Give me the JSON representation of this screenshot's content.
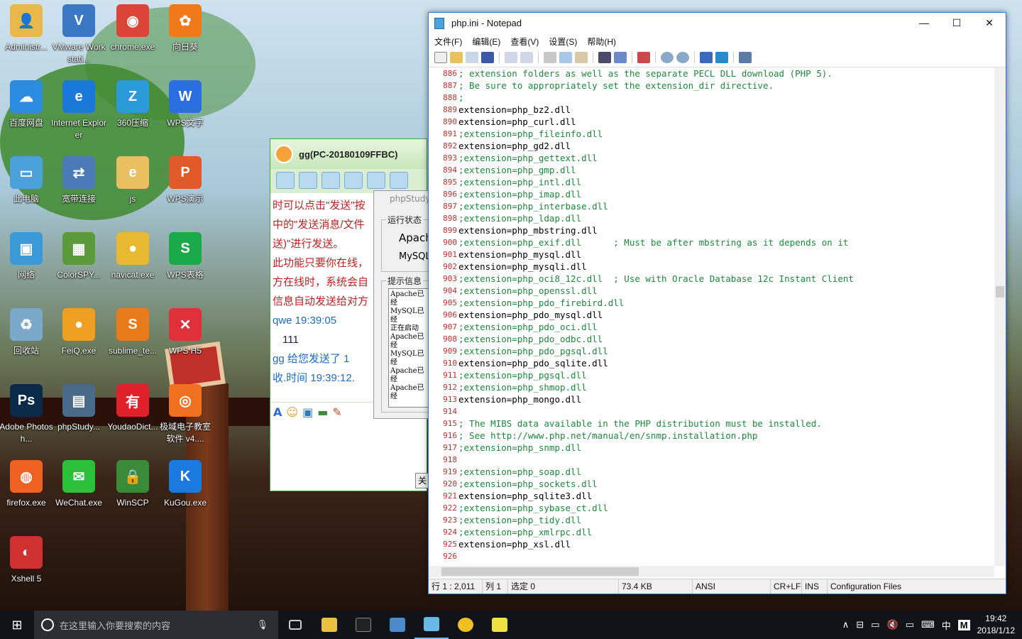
{
  "desktop": {
    "icons": [
      {
        "label": "Administr...",
        "color": "#e8b84a",
        "glyph": "👤"
      },
      {
        "label": "VMware Workstati...",
        "color": "#3a78c4",
        "glyph": "V"
      },
      {
        "label": "chrome.exe",
        "color": "#db4437",
        "glyph": "◉"
      },
      {
        "label": "向日葵",
        "color": "#f07a1a",
        "glyph": "✿"
      },
      {
        "label": "百度网盘",
        "color": "#2a8be0",
        "glyph": "☁"
      },
      {
        "label": "Internet Explorer",
        "color": "#1a78d8",
        "glyph": "e"
      },
      {
        "label": "360压缩",
        "color": "#2a9ad8",
        "glyph": "Z"
      },
      {
        "label": "WPS文字",
        "color": "#2a6ee0",
        "glyph": "W"
      },
      {
        "label": "此电脑",
        "color": "#4aa0d8",
        "glyph": "▭"
      },
      {
        "label": "宽带连接",
        "color": "#4a7ab8",
        "glyph": "⇄"
      },
      {
        "label": "js",
        "color": "#e8c060",
        "glyph": "e"
      },
      {
        "label": "WPS演示",
        "color": "#e05a2a",
        "glyph": "P"
      },
      {
        "label": "网络",
        "color": "#3a9ad8",
        "glyph": "▣"
      },
      {
        "label": "ColorSPY...",
        "color": "#5a9a3a",
        "glyph": "▦"
      },
      {
        "label": "navicat.exe",
        "color": "#e8b830",
        "glyph": "●"
      },
      {
        "label": "WPS表格",
        "color": "#1aaa4a",
        "glyph": "S"
      },
      {
        "label": "回收站",
        "color": "#7aa8c8",
        "glyph": "♻"
      },
      {
        "label": "FeiQ.exe",
        "color": "#f0a020",
        "glyph": "●"
      },
      {
        "label": "sublime_te...",
        "color": "#e87a1a",
        "glyph": "S"
      },
      {
        "label": "WPS H5",
        "color": "#e0303a",
        "glyph": "✕"
      },
      {
        "label": "Adobe Photosh...",
        "color": "#0a2a4a",
        "glyph": "Ps"
      },
      {
        "label": "phpStudy...",
        "color": "#4a6a8a",
        "glyph": "▤"
      },
      {
        "label": "YoudaoDict...",
        "color": "#e0202a",
        "glyph": "有"
      },
      {
        "label": "极域电子教室软件 v4....",
        "color": "#f07020",
        "glyph": "◎"
      },
      {
        "label": "firefox.exe",
        "color": "#f06020",
        "glyph": "◍"
      },
      {
        "label": "WeChat.exe",
        "color": "#2ac03a",
        "glyph": "✉"
      },
      {
        "label": "WinSCP",
        "color": "#3a8a3a",
        "glyph": "🔒"
      },
      {
        "label": "KuGou.exe",
        "color": "#1a7ae0",
        "glyph": "K"
      },
      {
        "label": "Xshell 5",
        "color": "#d03030",
        "glyph": "◐"
      }
    ]
  },
  "chat": {
    "title": "gg(PC-20180109FFBC)",
    "messages": [
      {
        "cls": "red",
        "text": "时可以点击\"发送\"按"
      },
      {
        "cls": "red",
        "text": "中的\"发送消息/文件"
      },
      {
        "cls": "red",
        "text": "送)\"进行发送。"
      },
      {
        "cls": "red",
        "text": "此功能只要你在线，"
      },
      {
        "cls": "red",
        "text": "方在线时，系统会自"
      },
      {
        "cls": "red",
        "text": "信息自动发送给对方"
      },
      {
        "cls": "blue",
        "text": "qwe 19:39:05"
      },
      {
        "cls": "ind",
        "text": "111"
      },
      {
        "cls": "blue",
        "text": "gg 给您发送了 1"
      },
      {
        "cls": "blue",
        "text": "收.时间 19:39:12."
      }
    ],
    "close_label": "关"
  },
  "phpstudy": {
    "title": "phpStudy",
    "status_group": "运行状态",
    "apache": "Apach",
    "mysql": "MySQL",
    "info_group": "提示信息",
    "log": [
      "Apache已经",
      "MySQL已经",
      "正在启动",
      "Apache已经",
      "MySQL已经",
      "Apache已经",
      "Apache已经"
    ]
  },
  "notepad": {
    "title": "php.ini - Notepad",
    "menu": [
      "文件(F)",
      "编辑(E)",
      "查看(V)",
      "设置(S)",
      "帮助(H)"
    ],
    "lines": [
      {
        "n": "886",
        "t": "; extension folders as well as the separate PECL DLL download (PHP 5).",
        "c": true
      },
      {
        "n": "887",
        "t": "; Be sure to appropriately set the extension_dir directive.",
        "c": true
      },
      {
        "n": "888",
        "t": ";",
        "c": true
      },
      {
        "n": "889",
        "t": "extension=php_bz2.dll",
        "c": false
      },
      {
        "n": "890",
        "t": "extension=php_curl.dll",
        "c": false
      },
      {
        "n": "891",
        "t": ";extension=php_fileinfo.dll",
        "c": true
      },
      {
        "n": "892",
        "t": "extension=php_gd2.dll",
        "c": false
      },
      {
        "n": "893",
        "t": ";extension=php_gettext.dll",
        "c": true
      },
      {
        "n": "894",
        "t": ";extension=php_gmp.dll",
        "c": true
      },
      {
        "n": "895",
        "t": ";extension=php_intl.dll",
        "c": true
      },
      {
        "n": "896",
        "t": ";extension=php_imap.dll",
        "c": true
      },
      {
        "n": "897",
        "t": ";extension=php_interbase.dll",
        "c": true
      },
      {
        "n": "898",
        "t": ";extension=php_ldap.dll",
        "c": true
      },
      {
        "n": "899",
        "t": "extension=php_mbstring.dll",
        "c": false
      },
      {
        "n": "900",
        "t": ";extension=php_exif.dll      ; Must be after mbstring as it depends on it",
        "c": true
      },
      {
        "n": "901",
        "t": "extension=php_mysql.dll",
        "c": false
      },
      {
        "n": "902",
        "t": "extension=php_mysqli.dll",
        "c": false
      },
      {
        "n": "903",
        "t": ";extension=php_oci8_12c.dll  ; Use with Oracle Database 12c Instant Client",
        "c": true
      },
      {
        "n": "904",
        "t": ";extension=php_openssl.dll",
        "c": true
      },
      {
        "n": "905",
        "t": ";extension=php_pdo_firebird.dll",
        "c": true
      },
      {
        "n": "906",
        "t": "extension=php_pdo_mysql.dll",
        "c": false
      },
      {
        "n": "907",
        "t": ";extension=php_pdo_oci.dll",
        "c": true
      },
      {
        "n": "908",
        "t": ";extension=php_pdo_odbc.dll",
        "c": true
      },
      {
        "n": "909",
        "t": ";extension=php_pdo_pgsql.dll",
        "c": true
      },
      {
        "n": "910",
        "t": "extension=php_pdo_sqlite.dll",
        "c": false
      },
      {
        "n": "911",
        "t": ";extension=php_pgsql.dll",
        "c": true
      },
      {
        "n": "912",
        "t": ";extension=php_shmop.dll",
        "c": true
      },
      {
        "n": "913",
        "t": "extension=php_mongo.dll",
        "c": false
      },
      {
        "n": "914",
        "t": "",
        "c": false
      },
      {
        "n": "915",
        "t": "; The MIBS data available in the PHP distribution must be installed.",
        "c": true
      },
      {
        "n": "916",
        "t": "; See http://www.php.net/manual/en/snmp.installation.php",
        "c": true
      },
      {
        "n": "917",
        "t": ";extension=php_snmp.dll",
        "c": true
      },
      {
        "n": "918",
        "t": "",
        "c": false
      },
      {
        "n": "919",
        "t": ";extension=php_soap.dll",
        "c": true
      },
      {
        "n": "920",
        "t": ";extension=php_sockets.dll",
        "c": true
      },
      {
        "n": "921",
        "t": "extension=php_sqlite3.dll",
        "c": false
      },
      {
        "n": "922",
        "t": ";extension=php_sybase_ct.dll",
        "c": true
      },
      {
        "n": "923",
        "t": ";extension=php_tidy.dll",
        "c": true
      },
      {
        "n": "924",
        "t": ";extension=php_xmlrpc.dll",
        "c": true
      },
      {
        "n": "925",
        "t": "extension=php_xsl.dll",
        "c": false
      },
      {
        "n": "926",
        "t": "",
        "c": false
      }
    ],
    "status": {
      "position": "行 1 : 2,011",
      "column": "列 1",
      "selection": "选定 0",
      "size": "73.4 KB",
      "encoding": "ANSI",
      "eol": "CR+LF",
      "mode": "INS",
      "filetype": "Configuration Files"
    }
  },
  "taskbar": {
    "search_placeholder": "在这里输入你要搜索的内容",
    "time": "19:42",
    "date": "2018/1/12",
    "ime": "中",
    "ime_mode": "M"
  }
}
